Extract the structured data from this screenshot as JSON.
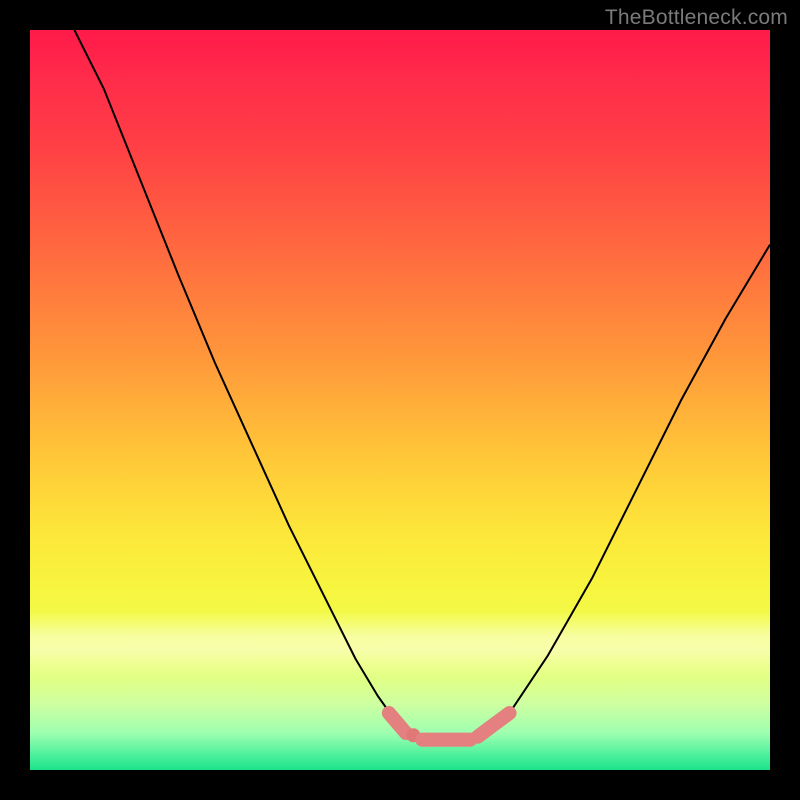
{
  "watermark": {
    "text": "TheBottleneck.com"
  },
  "colors": {
    "curve_black": "#000000",
    "accent_pink": "#e48080",
    "accent_pink_fill": "#e07878"
  },
  "chart_data": {
    "type": "line",
    "title": "",
    "xlabel": "",
    "ylabel": "",
    "xlim": [
      0,
      100
    ],
    "ylim": [
      0,
      100
    ],
    "note": "x/y are percentages of the plot area; y is from the TOP (0 = top edge, 100 = bottom edge). Two black curve branches descend into a flat trough; pink marker segments highlight points near the trough.",
    "series": [
      {
        "name": "left-branch",
        "color": "#000000",
        "x": [
          6,
          10,
          14,
          16,
          20,
          25,
          30,
          35,
          40,
          44,
          47,
          49.5,
          51.5
        ],
        "y": [
          0,
          8,
          18,
          23,
          33,
          45,
          56,
          67,
          77,
          85,
          90,
          93.5,
          95.2
        ]
      },
      {
        "name": "right-branch",
        "color": "#000000",
        "x": [
          62,
          65,
          70,
          76,
          82,
          88,
          94,
          100
        ],
        "y": [
          95.2,
          92,
          84.5,
          74,
          62,
          50,
          39,
          29
        ]
      },
      {
        "name": "trough",
        "color": "#000000",
        "x": [
          51.5,
          54,
          58,
          62
        ],
        "y": [
          95.2,
          95.8,
          95.8,
          95.2
        ]
      }
    ],
    "markers": [
      {
        "name": "pink-seg-1",
        "x": [
          48.5,
          50.8
        ],
        "y": [
          92.3,
          95.0
        ]
      },
      {
        "name": "pink-dot-1",
        "x": [
          51.8
        ],
        "y": [
          95.3
        ]
      },
      {
        "name": "pink-seg-2",
        "x": [
          53.0,
          59.5
        ],
        "y": [
          95.9,
          95.9
        ]
      },
      {
        "name": "pink-seg-3",
        "x": [
          60.5,
          64.8
        ],
        "y": [
          95.5,
          92.3
        ]
      }
    ]
  }
}
